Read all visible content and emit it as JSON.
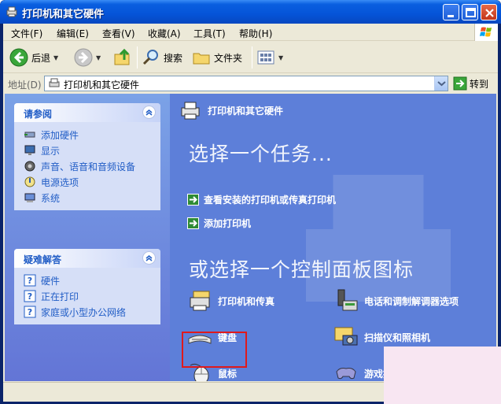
{
  "window": {
    "title": "打印机和其它硬件"
  },
  "menubar": {
    "items": [
      "文件(F)",
      "编辑(E)",
      "查看(V)",
      "收藏(A)",
      "工具(T)",
      "帮助(H)"
    ]
  },
  "toolbar": {
    "back": "后退",
    "search": "搜索",
    "folders": "文件夹"
  },
  "address": {
    "label": "地址(D)",
    "value": "打印机和其它硬件",
    "go": "转到"
  },
  "sidebar": {
    "see_also": {
      "title": "请参阅",
      "items": [
        "添加硬件",
        "显示",
        "声音、语音和音频设备",
        "电源选项",
        "系统"
      ]
    },
    "troubleshoot": {
      "title": "疑难解答",
      "items": [
        "硬件",
        "正在打印",
        "家庭或小型办公网络"
      ]
    }
  },
  "main": {
    "header": "打印机和其它硬件",
    "pick_task": "选择一个任务...",
    "tasks": [
      "查看安装的打印机或传真打印机",
      "添加打印机"
    ],
    "pick_icon": "或选择一个控制面板图标",
    "icons": [
      "打印机和传真",
      "电话和调制解调器选项",
      "键盘",
      "扫描仪和照相机",
      "鼠标",
      "游戏控制器"
    ]
  },
  "colors": {
    "highlight": "#e0191b",
    "title_bar": "#0554d8",
    "sidebar_link": "#215dc6"
  }
}
